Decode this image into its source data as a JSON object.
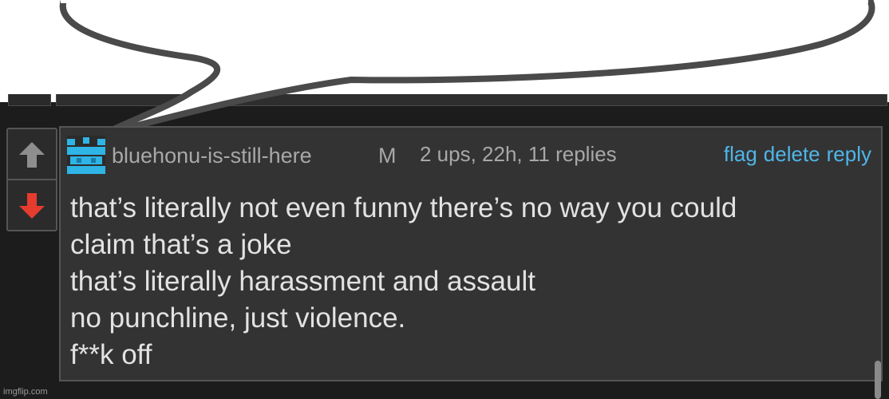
{
  "comment": {
    "username": "bluehonu-is-still-here",
    "badge": "M",
    "meta": "2 ups, 22h, 11 replies",
    "actions": {
      "flag": "flag",
      "delete": "delete",
      "reply": "reply"
    },
    "lines": [
      "that’s literally not even funny there’s no way you could",
      "claim that’s a joke",
      "that’s literally harassment and assault",
      "no punchline, just violence.",
      "f**k off"
    ],
    "votes": {
      "upvote_icon": "arrow-up-icon",
      "downvote_icon": "arrow-down-icon"
    }
  },
  "watermark": "imgflip.com",
  "colors": {
    "background": "#1c1c1c",
    "comment_bg": "#333333",
    "link": "#4fb6e8",
    "downvote": "#e63c2f",
    "upvote": "#8e8e8e",
    "avatar": "#2fb4e6"
  }
}
